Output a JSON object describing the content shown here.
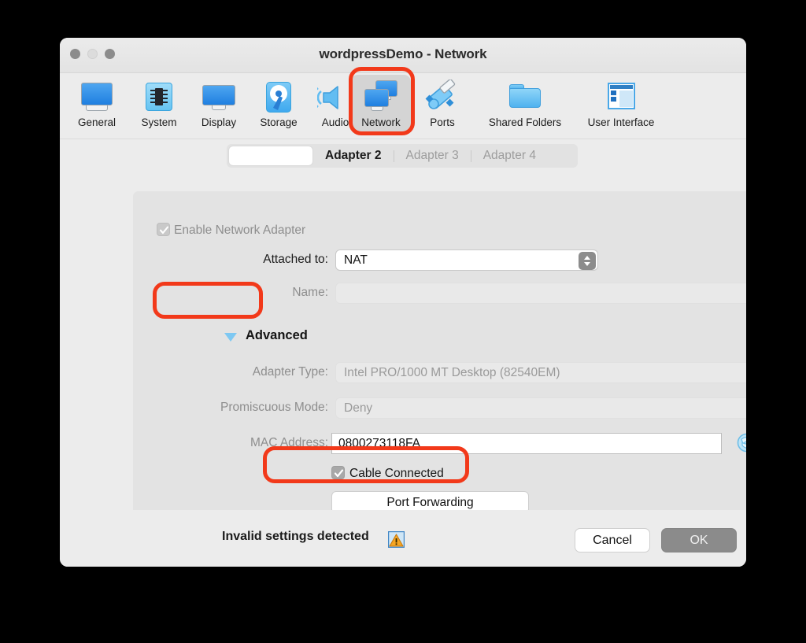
{
  "window": {
    "title": "wordpressDemo - Network",
    "traffic_lights": [
      "close-button",
      "minimize-button",
      "zoom-button"
    ]
  },
  "toolbar": {
    "items": [
      {
        "label": "General",
        "icon": "general-icon",
        "selected": false
      },
      {
        "label": "System",
        "icon": "system-icon",
        "selected": false
      },
      {
        "label": "Display",
        "icon": "display-icon",
        "selected": false
      },
      {
        "label": "Storage",
        "icon": "storage-icon",
        "selected": false
      },
      {
        "label": "Audio",
        "icon": "audio-icon",
        "selected": false
      },
      {
        "label": "Network",
        "icon": "network-icon",
        "selected": true
      },
      {
        "label": "Ports",
        "icon": "ports-icon",
        "selected": false
      },
      {
        "label": "Shared Folders",
        "icon": "shared-folders-icon",
        "selected": false
      },
      {
        "label": "User Interface",
        "icon": "user-interface-icon",
        "selected": false
      }
    ]
  },
  "tabs": [
    {
      "label": "",
      "state": "blank"
    },
    {
      "label": "Adapter 2",
      "state": "active"
    },
    {
      "label": "Adapter 3",
      "state": "inactive"
    },
    {
      "label": "Adapter 4",
      "state": "inactive"
    }
  ],
  "form": {
    "enable_adapter": {
      "label": "Enable Network Adapter",
      "checked": true,
      "enabled": false
    },
    "attached_to": {
      "label": "Attached to:",
      "value": "NAT",
      "enabled": true
    },
    "name": {
      "label": "Name:",
      "value": "",
      "enabled": false
    },
    "advanced": {
      "label": "Advanced",
      "expanded": true
    },
    "adapter_type": {
      "label": "Adapter Type:",
      "value": "Intel PRO/1000 MT Desktop (82540EM)",
      "enabled": false
    },
    "promiscuous_mode": {
      "label": "Promiscuous Mode:",
      "value": "Deny",
      "enabled": false
    },
    "mac_address": {
      "label": "MAC Address:",
      "value": "0800273118FA",
      "enabled": true,
      "refresh_icon": "refresh-icon"
    },
    "cable_connected": {
      "label": "Cable Connected",
      "checked": true,
      "enabled": false
    },
    "port_forwarding": {
      "label": "Port Forwarding"
    }
  },
  "footer": {
    "status_text": "Invalid settings detected",
    "status_icon": "warning-icon",
    "cancel_label": "Cancel",
    "ok_label": "OK"
  },
  "annotations": {
    "color": "#f2391a",
    "targets": [
      "network-toolbar-item",
      "advanced-disclosure",
      "port-forwarding-button"
    ]
  }
}
